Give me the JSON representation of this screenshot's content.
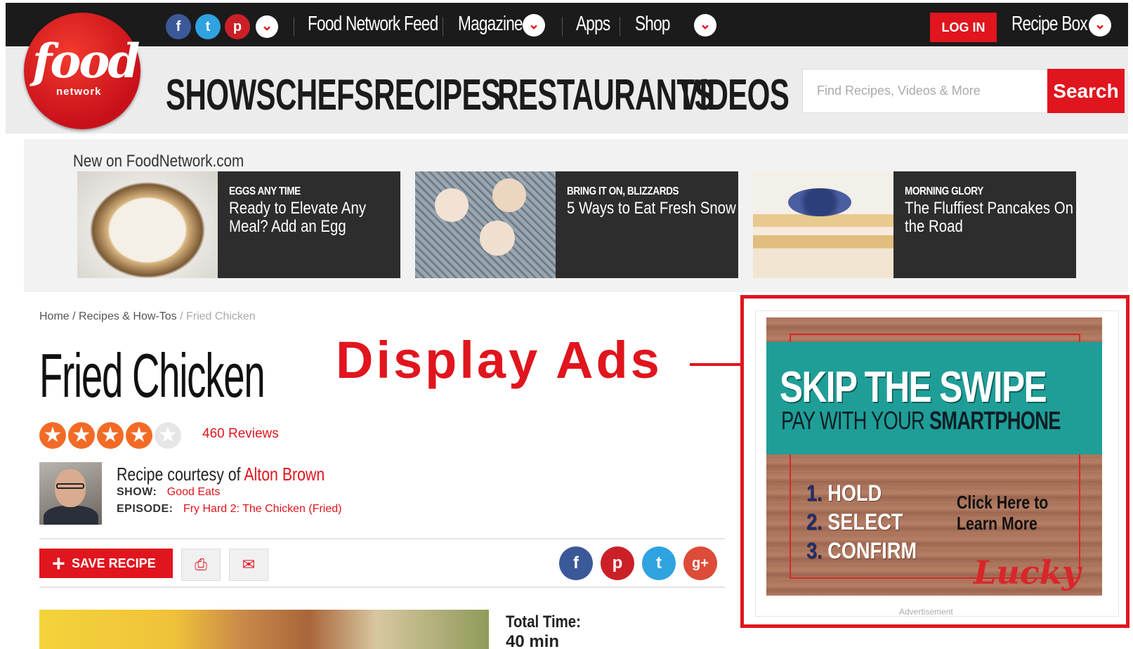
{
  "topbar": {
    "social_icons": [
      "facebook-icon",
      "twitter-icon",
      "pinterest-icon",
      "chevron-down-icon"
    ],
    "links": [
      "Food Network Feed",
      "Magazine",
      "Apps",
      "Shop"
    ],
    "login": "LOG IN",
    "recipe_box": "Recipe Box"
  },
  "logo": {
    "word": "food",
    "sub": "network"
  },
  "nav": [
    "SHOWS",
    "CHEFS",
    "RECIPES",
    "RESTAURANTS",
    "VIDEOS"
  ],
  "search": {
    "placeholder": "Find Recipes, Videos & More",
    "button": "Search"
  },
  "new_on": {
    "title": "New on FoodNetwork.com",
    "promos": [
      {
        "kicker": "EGGS ANY TIME",
        "headline": "Ready to Elevate Any Meal? Add an Egg"
      },
      {
        "kicker": "BRING IT ON, BLIZZARDS",
        "headline": "5 Ways to Eat Fresh Snow"
      },
      {
        "kicker": "MORNING GLORY",
        "headline": "The Fluffiest Pancakes On the Road"
      }
    ]
  },
  "breadcrumb": {
    "home": "Home",
    "section": "Recipes & How-Tos",
    "current": "Fried Chicken"
  },
  "recipe": {
    "title": "Fried Chicken",
    "rating": 4,
    "reviews": "460 Reviews",
    "courtesy_prefix": "Recipe courtesy of",
    "chef": "Alton Brown",
    "show_label": "SHOW:",
    "show": "Good Eats",
    "episode_label": "EPISODE:",
    "episode": "Fry Hard 2: The Chicken (Fried)",
    "save": "SAVE RECIPE",
    "total_time_label": "Total Time:",
    "total_time": "40 min"
  },
  "annotation": {
    "label": "Display Ads",
    "color": "#e0151e"
  },
  "ad": {
    "headline": "SKIP THE SWIPE",
    "sub_prefix": "PAY WITH YOUR",
    "sub_bold": "SMARTPHONE",
    "steps": [
      {
        "num": "1.",
        "text": "HOLD"
      },
      {
        "num": "2.",
        "text": "SELECT"
      },
      {
        "num": "3.",
        "text": "CONFIRM"
      }
    ],
    "cta_line1": "Click Here to",
    "cta_line2": "Learn More",
    "brand": "Lucky",
    "label": "Advertisement"
  },
  "colors": {
    "brand_red": "#e0151e",
    "topbar": "#1b1b1b",
    "ad_teal": "#1f9e98"
  }
}
